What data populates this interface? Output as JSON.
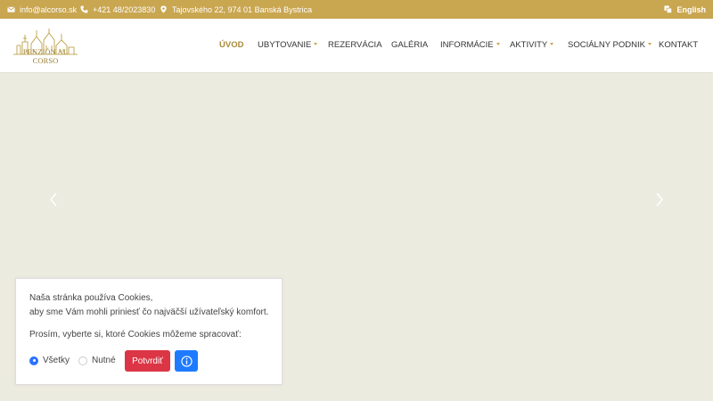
{
  "topbar": {
    "email": "info@alcorso.sk",
    "phone": "+421 48/2023830",
    "address": "Tajovského 22, 974 01 Banská Bystrica",
    "language": "English",
    "email_icon": "envelope-icon",
    "phone_icon": "phone-icon",
    "address_icon": "map-pin-icon",
    "language_icon": "translate-icon"
  },
  "logo": {
    "text": "PENZIÓN AL CORSO"
  },
  "nav": {
    "items": [
      {
        "label": "ÚVOD",
        "active": true,
        "dropdown": false
      },
      {
        "label": "UBYTOVANIE",
        "active": false,
        "dropdown": true
      },
      {
        "label": "REZERVÁCIA",
        "active": false,
        "dropdown": false
      },
      {
        "label": "GALÉRIA",
        "active": false,
        "dropdown": false
      },
      {
        "label": "INFORMÁCIE",
        "active": false,
        "dropdown": true
      },
      {
        "label": "AKTIVITY",
        "active": false,
        "dropdown": true
      },
      {
        "label": "SOCIÁLNY PODNIK",
        "active": false,
        "dropdown": true
      },
      {
        "label": "KONTAKT",
        "active": false,
        "dropdown": false
      }
    ]
  },
  "slider": {
    "prev_icon": "chevron-left-icon",
    "next_icon": "chevron-right-icon"
  },
  "cookie": {
    "line1": "Naša stránka používa Cookies,",
    "line2": "aby sme Vám mohli priniesť čo najväčší užívateľský komfort.",
    "prompt": "Prosím, vyberte si, ktoré Cookies môžeme spracovať:",
    "option_all": "Všetky",
    "option_necessary": "Nutné",
    "selected": "Všetky",
    "confirm": "Potvrdiť",
    "info_icon": "info-circle-icon"
  },
  "colors": {
    "accent": "#c9a650",
    "confirm": "#dc3545",
    "info": "#1e7bff",
    "hero": "#ecebe0"
  }
}
